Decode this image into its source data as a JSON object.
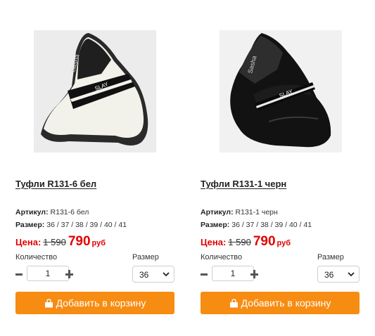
{
  "products": [
    {
      "title": "Туфли R131-6 бел",
      "article_label": "Артикул:",
      "article": "R131-6 бел",
      "size_label": "Размер:",
      "sizes": "36 / 37 / 38 / 39 / 40 / 41",
      "price_label": "Цена:",
      "old_price": "1 590",
      "new_price": "790",
      "currency": "руб",
      "quantity_label": "Количество",
      "quantity": "1",
      "size_select_label": "Размер",
      "selected_size": "36",
      "add_to_cart": "Добавить в корзину",
      "color": "white",
      "image_icon": "loafer-white-icon"
    },
    {
      "title": "Туфли R131-1 черн",
      "article_label": "Артикул:",
      "article": "R131-1 черн",
      "size_label": "Размер:",
      "sizes": "36 / 37 / 38 / 39 / 40 / 41",
      "price_label": "Цена:",
      "old_price": "1 590",
      "new_price": "790",
      "currency": "руб",
      "quantity_label": "Количество",
      "quantity": "1",
      "size_select_label": "Размер",
      "selected_size": "36",
      "add_to_cart": "Добавить в корзину",
      "color": "black",
      "image_icon": "loafer-black-icon"
    }
  ],
  "strap_text": "SLAY",
  "insole_brand": "Sasha",
  "colors": {
    "accent_button": "#f78c12",
    "price_red": "#e30000"
  }
}
